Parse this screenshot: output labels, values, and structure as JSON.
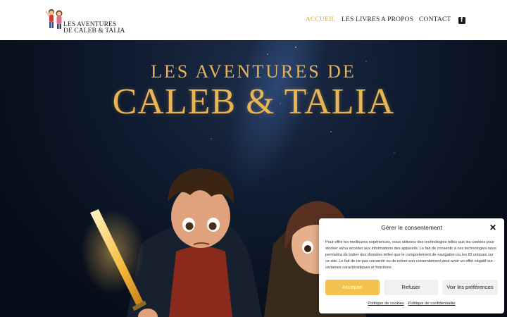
{
  "header": {
    "logo_line1": "LES AVENTURES",
    "logo_line2": "DE CALEB & TALIA",
    "nav": [
      "ACCUEIL",
      "LES LIVRES",
      "A PROPOS",
      "CONTACT"
    ],
    "social_icon": "facebook-icon",
    "accent_color": "#d9a93b"
  },
  "hero": {
    "title_line1": "LES AVENTURES DE",
    "title_line2": "CALEB & TALIA"
  },
  "consent": {
    "title": "Gérer le consentement",
    "text": "Pour offrir les meilleures expériences, nous utilisons des technologies telles que les cookies pour stocker et/ou accéder aux informations des appareils. Le fait de consentir à ces technologies nous permettra de traiter des données telles que le comportement de navigation ou les ID uniques sur ce site. Le fait de ne pas consentir ou de retirer son consentement peut avoir un effet négatif sur certaines caractéristiques et fonctions.",
    "accept": "Accepter",
    "refuse": "Refuser",
    "prefs": "Voir les préférences",
    "link_cookies": "Politique de cookies",
    "link_privacy": "Politique de confidentialité",
    "accept_color": "#f2c14e"
  }
}
